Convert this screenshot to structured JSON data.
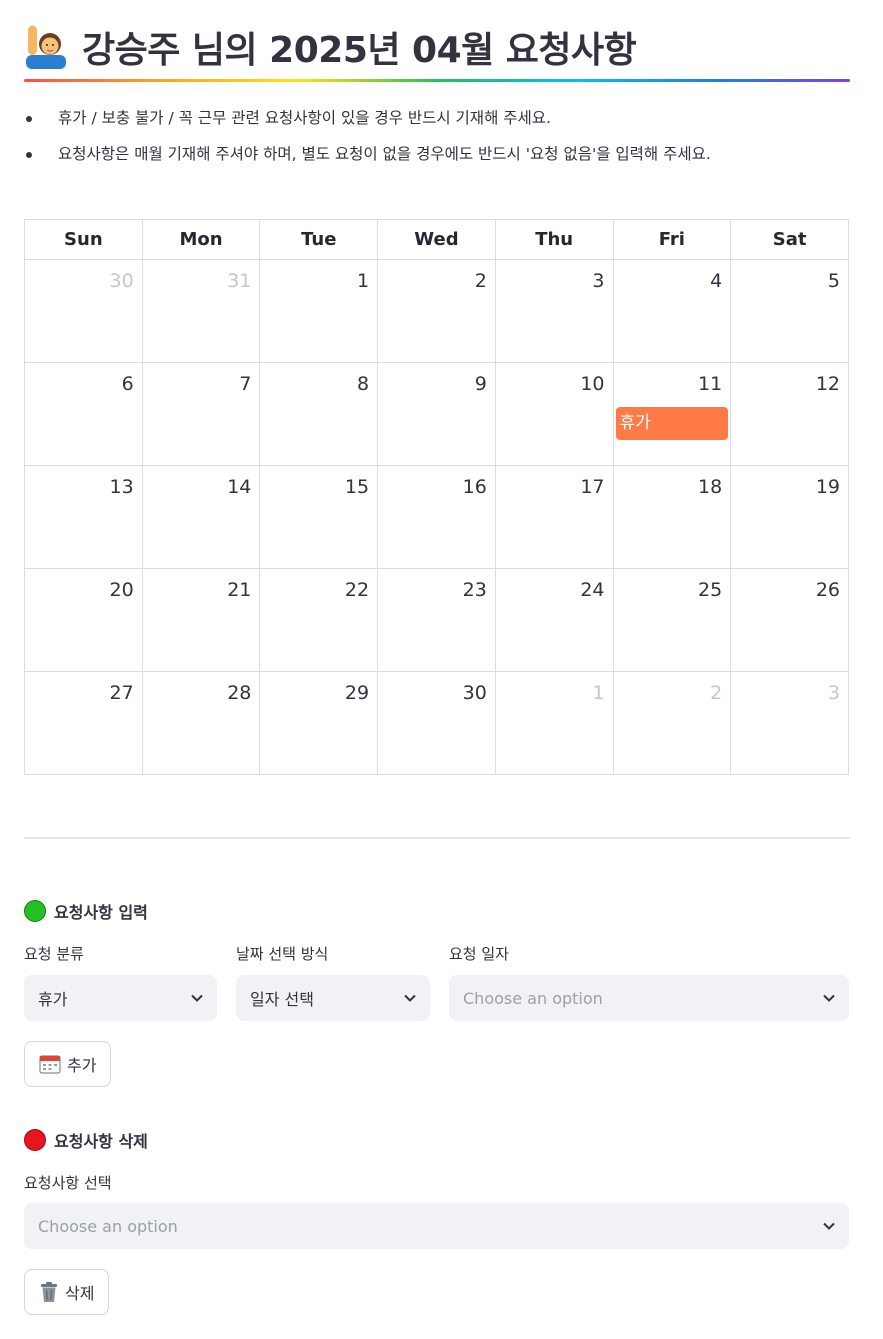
{
  "header": {
    "title": "강승주 님의 2025년 04월 요청사항",
    "icon": "person-raising-hand-icon"
  },
  "notes": [
    "휴가 / 보충 불가 / 꼭 근무 관련 요청사항이 있을 경우 반드시 기재해 주세요.",
    "요청사항은 매월 기재해 주셔야 하며, 별도 요청이 없을 경우에도 반드시 '요청 없음'을 입력해 주세요."
  ],
  "calendar": {
    "weekdays": [
      "Sun",
      "Mon",
      "Tue",
      "Wed",
      "Thu",
      "Fri",
      "Sat"
    ],
    "weeks": [
      [
        {
          "d": "30",
          "muted": true
        },
        {
          "d": "31",
          "muted": true
        },
        {
          "d": "1"
        },
        {
          "d": "2"
        },
        {
          "d": "3"
        },
        {
          "d": "4"
        },
        {
          "d": "5"
        }
      ],
      [
        {
          "d": "6"
        },
        {
          "d": "7"
        },
        {
          "d": "8"
        },
        {
          "d": "9"
        },
        {
          "d": "10"
        },
        {
          "d": "11",
          "event": "휴가"
        },
        {
          "d": "12"
        }
      ],
      [
        {
          "d": "13"
        },
        {
          "d": "14"
        },
        {
          "d": "15"
        },
        {
          "d": "16"
        },
        {
          "d": "17"
        },
        {
          "d": "18"
        },
        {
          "d": "19"
        }
      ],
      [
        {
          "d": "20"
        },
        {
          "d": "21"
        },
        {
          "d": "22"
        },
        {
          "d": "23"
        },
        {
          "d": "24"
        },
        {
          "d": "25"
        },
        {
          "d": "26"
        }
      ],
      [
        {
          "d": "27"
        },
        {
          "d": "28"
        },
        {
          "d": "29"
        },
        {
          "d": "30"
        },
        {
          "d": "1",
          "muted": true
        },
        {
          "d": "2",
          "muted": true
        },
        {
          "d": "3",
          "muted": true
        }
      ]
    ],
    "event_color": "#ff7a45"
  },
  "input_section": {
    "title": "요청사항 입력",
    "dot_color": "#22c222",
    "category_label": "요청 분류",
    "category_value": "휴가",
    "date_mode_label": "날짜 선택 방식",
    "date_mode_value": "일자 선택",
    "date_label": "요청 일자",
    "date_placeholder": "Choose an option",
    "add_button": "추가",
    "add_icon": "calendar-icon"
  },
  "delete_section": {
    "title": "요청사항 삭제",
    "dot_color": "#e8141e",
    "select_label": "요청사항 선택",
    "select_placeholder": "Choose an option",
    "delete_button": "삭제",
    "delete_icon": "trash-can-icon"
  }
}
